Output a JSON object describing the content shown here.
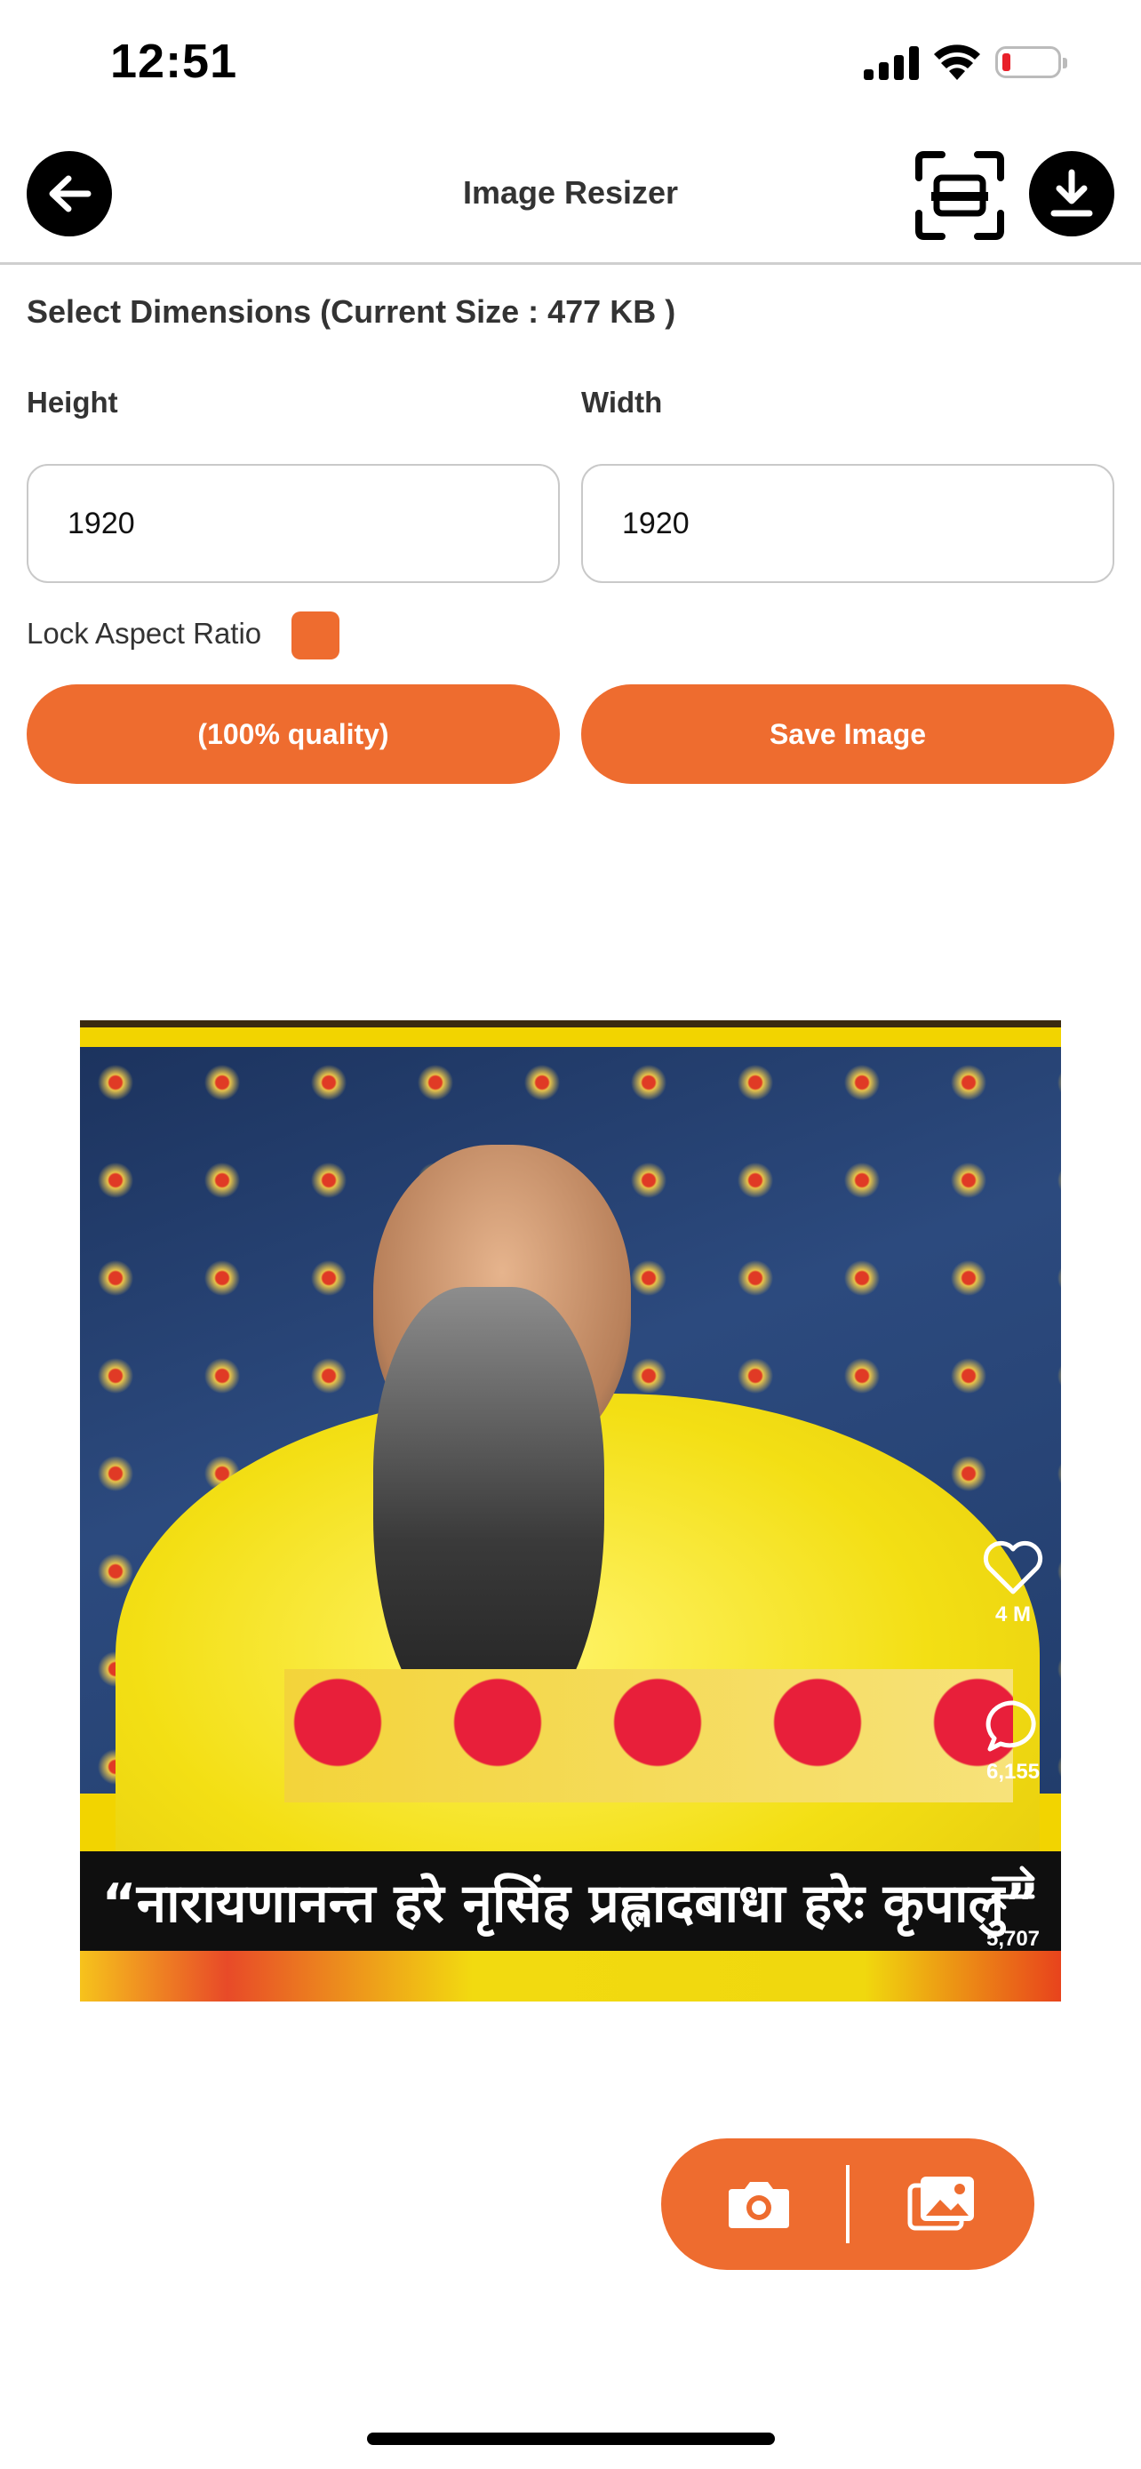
{
  "status_bar": {
    "time": "12:51"
  },
  "header": {
    "title": "Image Resizer"
  },
  "form": {
    "section_label": "Select Dimensions (Current Size : 477 KB )",
    "height_label": "Height",
    "width_label": "Width",
    "height_value": "1920",
    "width_value": "1920",
    "lock_label": "Lock Aspect Ratio",
    "lock_checked": true,
    "quality_button": "(100% quality)",
    "save_button": "Save Image"
  },
  "preview": {
    "caption": "“नारायणानन्त हरे नृसिंह प्रह्लादबाधा हरेः कृपालु”",
    "likes": "4 M",
    "comments": "6,155",
    "shares": "5,707"
  },
  "colors": {
    "accent": "#ee6c2f",
    "icon_dark": "#000000"
  }
}
